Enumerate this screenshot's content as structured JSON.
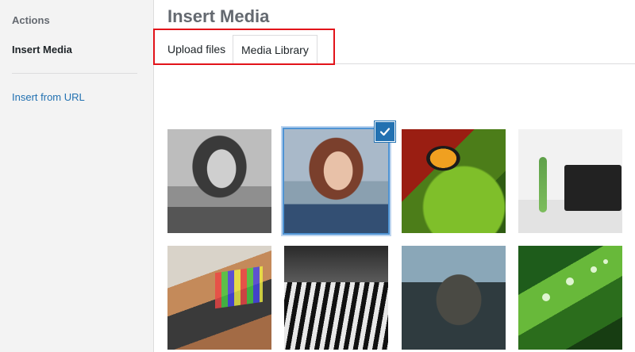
{
  "sidebar": {
    "heading": "Actions",
    "items": [
      {
        "label": "Insert Media",
        "active": true
      },
      {
        "label": "Insert from URL",
        "link": true
      }
    ]
  },
  "main": {
    "title": "Insert Media",
    "tabs": [
      {
        "label": "Upload files"
      },
      {
        "label": "Media Library",
        "active": true
      }
    ],
    "thumbnails": [
      {
        "icon": "portrait-bw-image"
      },
      {
        "icon": "portrait-color-image",
        "selected": true
      },
      {
        "icon": "butterfly-image"
      },
      {
        "icon": "laptop-plant-image"
      },
      {
        "icon": "laptop-typing-image"
      },
      {
        "icon": "zebras-image"
      },
      {
        "icon": "elephant-image"
      },
      {
        "icon": "dew-leaf-image"
      }
    ]
  },
  "colors": {
    "link": "#2271b1",
    "highlight_box": "#e2131a",
    "selection": "#2271b1"
  }
}
